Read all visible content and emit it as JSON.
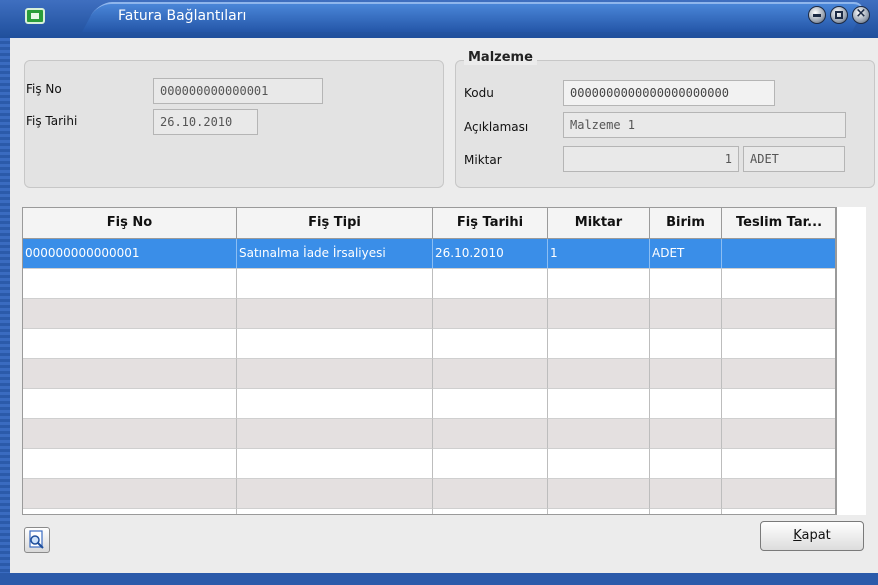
{
  "window": {
    "title": "Fatura Bağlantıları",
    "accent": "#1f4f9c"
  },
  "header": {
    "fis_no_label": "Fiş No",
    "fis_no_value": "000000000000001",
    "fis_tarihi_label": "Fiş Tarihi",
    "fis_tarihi_value": "26.10.2010"
  },
  "malzeme": {
    "title": "Malzeme",
    "kodu_label": "Kodu",
    "kodu_value": "0000000000000000000000",
    "aciklama_label": "Açıklaması",
    "aciklama_value": "Malzeme 1",
    "miktar_label": "Miktar",
    "miktar_value": "1",
    "birim_value": "ADET"
  },
  "grid": {
    "columns": [
      "Fiş No",
      "Fiş Tipi",
      "Fiş Tarihi",
      "Miktar",
      "Birim",
      "Teslim Tar..."
    ],
    "rows": [
      [
        "000000000000001",
        "Satınalma İade İrsaliyesi",
        "26.10.2010",
        "1",
        "ADET",
        ""
      ]
    ],
    "selected_color": "#3a8ee8"
  },
  "footer": {
    "kapat_label_underlined": "K",
    "kapat_label_rest": "apat",
    "preview_icon": "print-preview-icon"
  }
}
